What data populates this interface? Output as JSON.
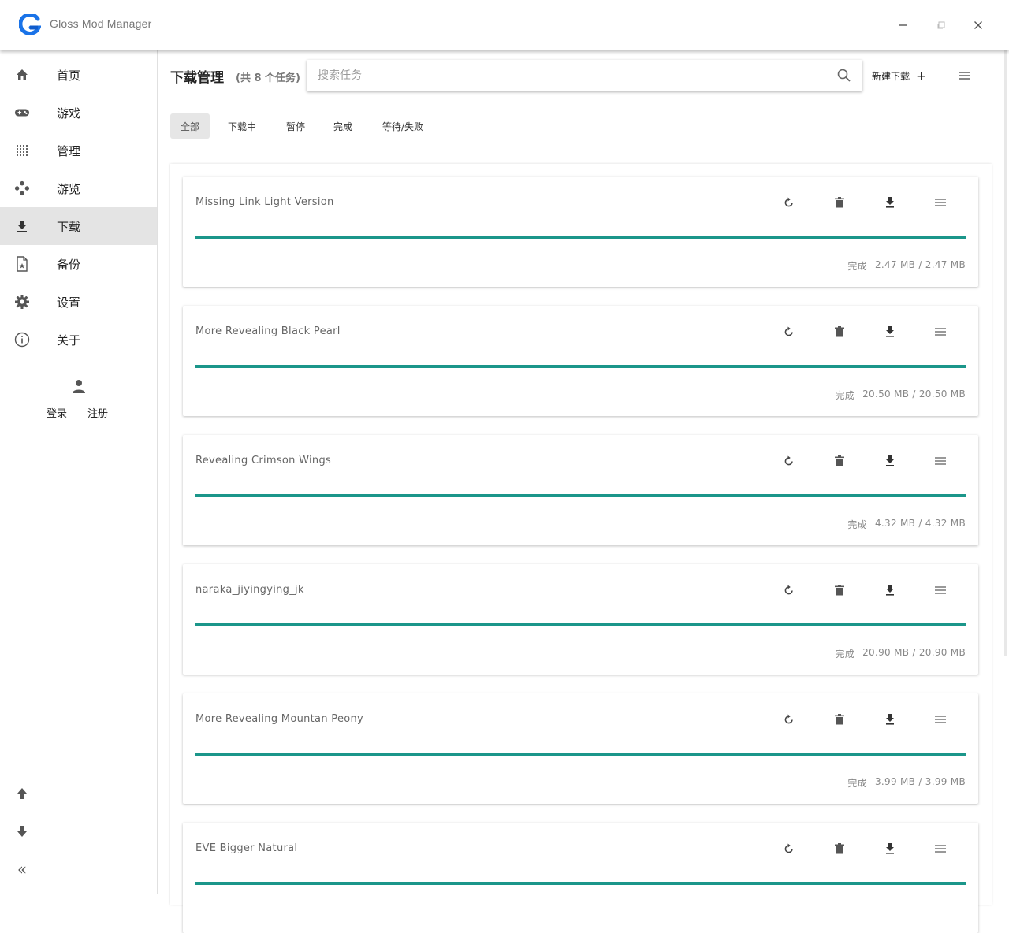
{
  "app": {
    "title": "Gloss Mod Manager",
    "brand_color": "#1a73e8"
  },
  "window_controls": {
    "minimize": "−",
    "maximize": "▫",
    "close": "✕"
  },
  "sidebar": {
    "items": [
      {
        "label": "首页",
        "icon": "home-icon"
      },
      {
        "label": "游戏",
        "icon": "gamepad-icon"
      },
      {
        "label": "管理",
        "icon": "grid-icon"
      },
      {
        "label": "游览",
        "icon": "explore-icon"
      },
      {
        "label": "下载",
        "icon": "download-icon",
        "active": true
      },
      {
        "label": "备份",
        "icon": "backup-file-icon"
      },
      {
        "label": "设置",
        "icon": "gear-icon"
      },
      {
        "label": "关于",
        "icon": "info-icon"
      }
    ],
    "user": {
      "login": "登录",
      "register": "注册"
    },
    "bottom": {
      "up": "arrow-up-icon",
      "down": "arrow-down-icon",
      "collapse": "«"
    }
  },
  "header": {
    "title": "下载管理",
    "count": "(共 8 个任务)",
    "search_placeholder": "搜索任务",
    "new_download": "新建下载",
    "plus": "+"
  },
  "tabs": [
    {
      "label": "全部",
      "active": true
    },
    {
      "label": "下载中"
    },
    {
      "label": "暂停"
    },
    {
      "label": "完成"
    },
    {
      "label": "等待/失败"
    }
  ],
  "tasks": [
    {
      "name": "Missing Link Light Version",
      "status": "完成",
      "size": "2.47 MB / 2.47 MB",
      "progress": 100
    },
    {
      "name": "More Revealing Black Pearl",
      "status": "完成",
      "size": "20.50 MB / 20.50 MB",
      "progress": 100
    },
    {
      "name": "Revealing Crimson Wings",
      "status": "完成",
      "size": "4.32 MB / 4.32 MB",
      "progress": 100
    },
    {
      "name": "naraka_jiyingying_jk",
      "status": "完成",
      "size": "20.90 MB / 20.90 MB",
      "progress": 100
    },
    {
      "name": "More Revealing Mountan Peony",
      "status": "完成",
      "size": "3.99 MB / 3.99 MB",
      "progress": 100
    },
    {
      "name": "EVE Bigger Natural",
      "status": "",
      "size": "",
      "progress": 100
    }
  ],
  "colors": {
    "progress": "#1b968a",
    "active_nav": "#e4e4e4"
  }
}
